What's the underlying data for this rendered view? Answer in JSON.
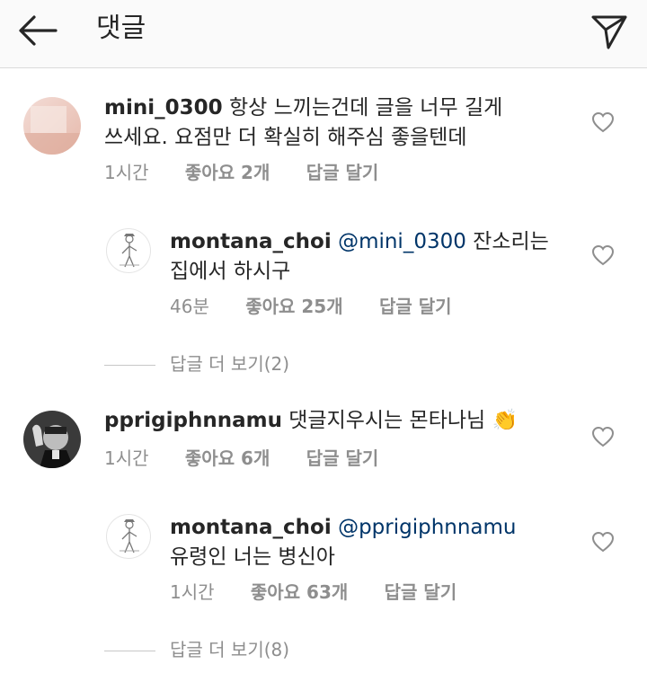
{
  "header": {
    "title": "댓글"
  },
  "comments": [
    {
      "username": "mini_0300",
      "text_line1": "항상 느끼는건데 글을 너무 길게",
      "text_line2": "쓰세요. 요점만 더 확실히 해주심 좋을텐데",
      "time": "1시간",
      "likes": "좋아요 2개",
      "reply": "답글 달기",
      "replies": [
        {
          "username": "montana_choi",
          "mention": "@mini_0300",
          "text_line1": "잔소리는",
          "text_line2": "집에서 하시구",
          "time": "46분",
          "likes": "좋아요 25개",
          "reply": "답글 달기"
        }
      ],
      "view_more": "답글 더 보기(2)"
    },
    {
      "username": "pprigiphnnamu",
      "text_line1": "댓글지우시는 몬타나님 👏",
      "time": "1시간",
      "likes": "좋아요 6개",
      "reply": "답글 달기",
      "replies": [
        {
          "username": "montana_choi",
          "mention": "@pprigiphnnamu",
          "text_line2": "유령인 너는 병신아",
          "time": "1시간",
          "likes": "좋아요 63개",
          "reply": "답글 달기"
        }
      ],
      "view_more": "답글 더 보기(8)"
    }
  ],
  "icons": {
    "back": "back-arrow-icon",
    "send": "paper-plane-icon",
    "like": "heart-outline-icon"
  },
  "colors": {
    "text": "#262626",
    "secondary": "#8e8e8e",
    "mention": "#003569",
    "header_bg": "#fafafa"
  }
}
